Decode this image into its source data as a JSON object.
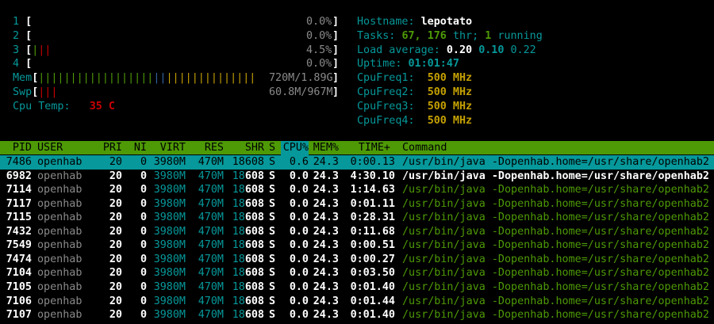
{
  "meters": {
    "cpus": [
      {
        "id": "1",
        "bars": "",
        "value": "0.0%"
      },
      {
        "id": "2",
        "bars": "",
        "value": "0.0%"
      },
      {
        "id": "3",
        "bars": "|||",
        "value": "4.5%"
      },
      {
        "id": "4",
        "bars": "",
        "value": "0.0%"
      }
    ],
    "mem": {
      "label": "Mem",
      "bars": "||||||||||||||||||||||||||||||||||",
      "value": "720M/1.89G"
    },
    "swp": {
      "label": "Swp",
      "bars": "|||",
      "value": "60.8M/967M"
    },
    "cpu_temp": {
      "label": "Cpu Temp:",
      "value": "35 C"
    }
  },
  "info": {
    "hostname_label": "Hostname:",
    "hostname": "lepotato",
    "tasks_label": "Tasks:",
    "tasks": "67,",
    "threads": "176",
    "thr_label": "thr;",
    "running": "1",
    "running_label": "running",
    "load_label": "Load average:",
    "load1": "0.20",
    "load5": "0.10",
    "load15": "0.22",
    "uptime_label": "Uptime:",
    "uptime": "01:01:47",
    "freqs": [
      {
        "label": "CpuFreq1:",
        "value": "500 MHz"
      },
      {
        "label": "CpuFreq2:",
        "value": "500 MHz"
      },
      {
        "label": "CpuFreq3:",
        "value": "500 MHz"
      },
      {
        "label": "CpuFreq4:",
        "value": "500 MHz"
      }
    ]
  },
  "header": {
    "pid": "PID",
    "user": "USER",
    "pri": "PRI",
    "ni": "NI",
    "virt": "VIRT",
    "res": "RES",
    "shr": "SHR",
    "s": "S",
    "cpu": "CPU%",
    "mem": "MEM%",
    "time": "TIME+",
    "command": "Command"
  },
  "processes": [
    {
      "pid": "7486",
      "user": "openhab",
      "pri": "20",
      "ni": "0",
      "virt": "3980M",
      "res": "470M",
      "shr_a": "18",
      "shr_b": "608",
      "s": "S",
      "cpu": "0.6",
      "mem": "24.3",
      "time_a": "0:00.",
      "time_b": "13",
      "cmd_a": "/usr/bin/java",
      "cmd_b": " -Dopenhab.home=/usr/share/openhab2"
    },
    {
      "pid": "6982",
      "user": "openhab",
      "pri": "20",
      "ni": "0",
      "virt": "3980M",
      "res": "470M",
      "shr_a": "18",
      "shr_b": "608",
      "s": "S",
      "cpu": "0.0",
      "mem": "24.3",
      "time_a": "4:30.",
      "time_b": "10",
      "cmd_a": "/usr/bin/java",
      "cmd_b": " -Dopenhab.home=/usr/share/openhab2"
    },
    {
      "pid": "7114",
      "user": "openhab",
      "pri": "20",
      "ni": "0",
      "virt": "3980M",
      "res": "470M",
      "shr_a": "18",
      "shr_b": "608",
      "s": "S",
      "cpu": "0.0",
      "mem": "24.3",
      "time_a": "1:14.",
      "time_b": "63",
      "cmd_a": "/usr/bin/java",
      "cmd_b": " -Dopenhab.home=/usr/share/openhab2"
    },
    {
      "pid": "7117",
      "user": "openhab",
      "pri": "20",
      "ni": "0",
      "virt": "3980M",
      "res": "470M",
      "shr_a": "18",
      "shr_b": "608",
      "s": "S",
      "cpu": "0.0",
      "mem": "24.3",
      "time_a": "0:01.",
      "time_b": "11",
      "cmd_a": "/usr/bin/java",
      "cmd_b": " -Dopenhab.home=/usr/share/openhab2"
    },
    {
      "pid": "7115",
      "user": "openhab",
      "pri": "20",
      "ni": "0",
      "virt": "3980M",
      "res": "470M",
      "shr_a": "18",
      "shr_b": "608",
      "s": "S",
      "cpu": "0.0",
      "mem": "24.3",
      "time_a": "0:28.",
      "time_b": "31",
      "cmd_a": "/usr/bin/java",
      "cmd_b": " -Dopenhab.home=/usr/share/openhab2"
    },
    {
      "pid": "7432",
      "user": "openhab",
      "pri": "20",
      "ni": "0",
      "virt": "3980M",
      "res": "470M",
      "shr_a": "18",
      "shr_b": "608",
      "s": "S",
      "cpu": "0.0",
      "mem": "24.3",
      "time_a": "0:11.",
      "time_b": "68",
      "cmd_a": "/usr/bin/java",
      "cmd_b": " -Dopenhab.home=/usr/share/openhab2"
    },
    {
      "pid": "7549",
      "user": "openhab",
      "pri": "20",
      "ni": "0",
      "virt": "3980M",
      "res": "470M",
      "shr_a": "18",
      "shr_b": "608",
      "s": "S",
      "cpu": "0.0",
      "mem": "24.3",
      "time_a": "0:00.",
      "time_b": "51",
      "cmd_a": "/usr/bin/java",
      "cmd_b": " -Dopenhab.home=/usr/share/openhab2"
    },
    {
      "pid": "7474",
      "user": "openhab",
      "pri": "20",
      "ni": "0",
      "virt": "3980M",
      "res": "470M",
      "shr_a": "18",
      "shr_b": "608",
      "s": "S",
      "cpu": "0.0",
      "mem": "24.3",
      "time_a": "0:00.",
      "time_b": "27",
      "cmd_a": "/usr/bin/java",
      "cmd_b": " -Dopenhab.home=/usr/share/openhab2"
    },
    {
      "pid": "7104",
      "user": "openhab",
      "pri": "20",
      "ni": "0",
      "virt": "3980M",
      "res": "470M",
      "shr_a": "18",
      "shr_b": "608",
      "s": "S",
      "cpu": "0.0",
      "mem": "24.3",
      "time_a": "0:03.",
      "time_b": "50",
      "cmd_a": "/usr/bin/java",
      "cmd_b": " -Dopenhab.home=/usr/share/openhab2"
    },
    {
      "pid": "7105",
      "user": "openhab",
      "pri": "20",
      "ni": "0",
      "virt": "3980M",
      "res": "470M",
      "shr_a": "18",
      "shr_b": "608",
      "s": "S",
      "cpu": "0.0",
      "mem": "24.3",
      "time_a": "0:01.",
      "time_b": "40",
      "cmd_a": "/usr/bin/java",
      "cmd_b": " -Dopenhab.home=/usr/share/openhab2"
    },
    {
      "pid": "7106",
      "user": "openhab",
      "pri": "20",
      "ni": "0",
      "virt": "3980M",
      "res": "470M",
      "shr_a": "18",
      "shr_b": "608",
      "s": "S",
      "cpu": "0.0",
      "mem": "24.3",
      "time_a": "0:01.",
      "time_b": "44",
      "cmd_a": "/usr/bin/java",
      "cmd_b": " -Dopenhab.home=/usr/share/openhab2"
    },
    {
      "pid": "7107",
      "user": "openhab",
      "pri": "20",
      "ni": "0",
      "virt": "3980M",
      "res": "470M",
      "shr_a": "18",
      "shr_b": "608",
      "s": "S",
      "cpu": "0.0",
      "mem": "24.3",
      "time_a": "0:01.",
      "time_b": "40",
      "cmd_a": "/usr/bin/java",
      "cmd_b": " -Dopenhab.home=/usr/share/openhab2"
    }
  ],
  "colors": {
    "header_bg": "#4e9a06",
    "selected_bg": "#06989a",
    "label": "#06989a",
    "value_bold": "#ffffff",
    "freq": "#c4a000",
    "temp": "#cc0000"
  }
}
